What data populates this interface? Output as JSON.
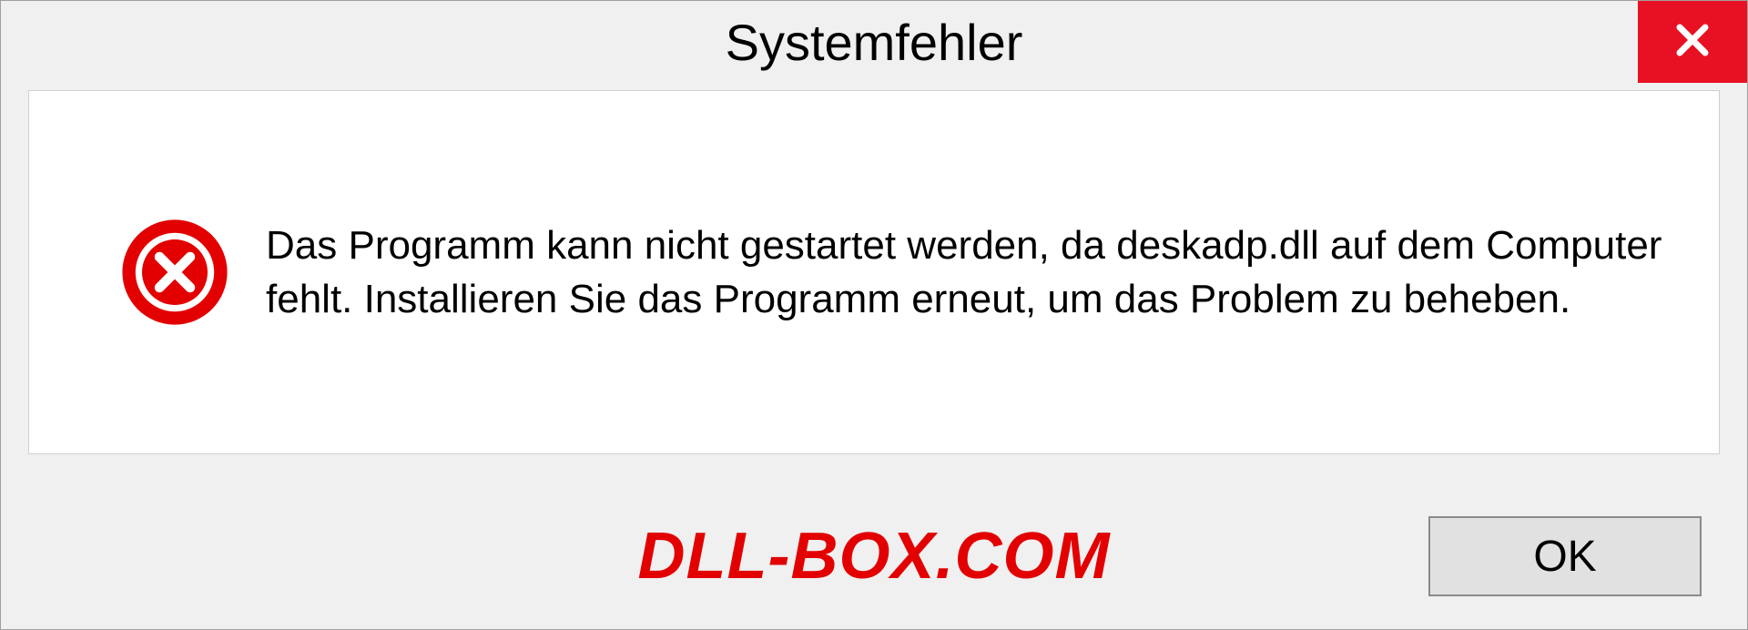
{
  "titlebar": {
    "title": "Systemfehler"
  },
  "content": {
    "message": "Das Programm kann nicht gestartet werden, da deskadp.dll auf dem Computer fehlt. Installieren Sie das Programm erneut, um das Problem zu beheben."
  },
  "footer": {
    "watermark": "DLL-BOX.COM",
    "ok_label": "OK"
  },
  "colors": {
    "close_button": "#e81123",
    "error_icon": "#e20000",
    "watermark": "#e20000"
  }
}
